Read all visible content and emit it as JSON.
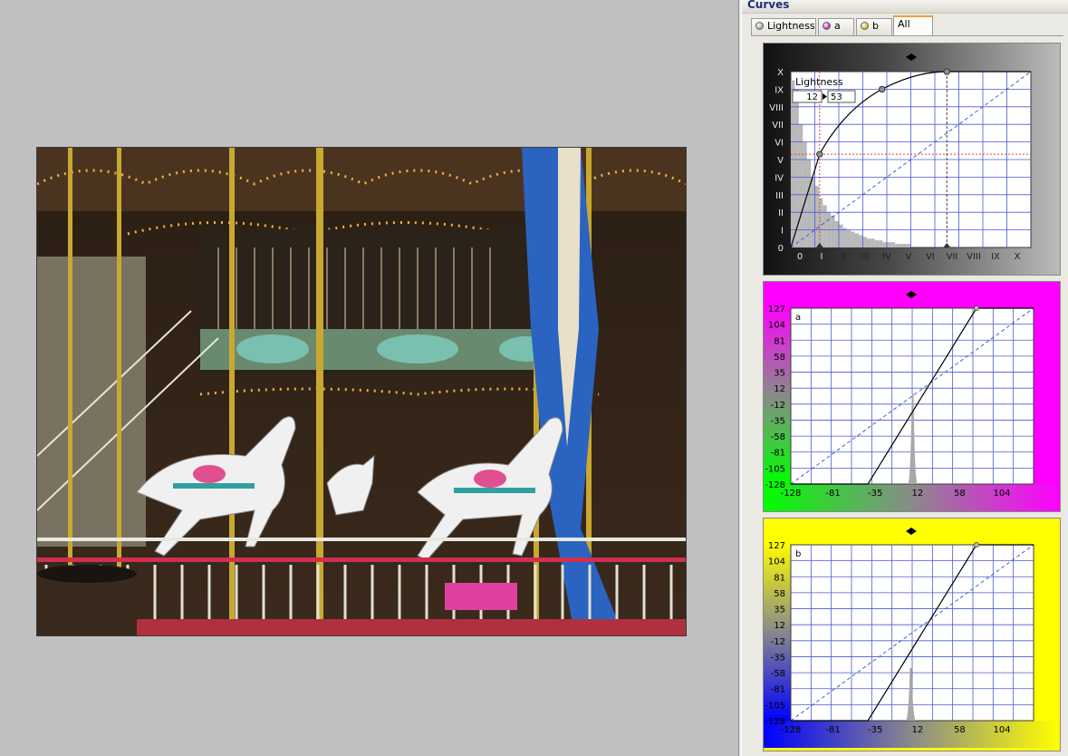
{
  "panel": {
    "title": "Curves",
    "tabs": [
      {
        "label": "Lightness",
        "icon": "gray-sphere-icon",
        "color": "#808080"
      },
      {
        "label": "a",
        "icon": "magenta-green-sphere-icon",
        "color": "#c040c0"
      },
      {
        "label": "b",
        "icon": "yellow-blue-sphere-icon",
        "color": "#60a040"
      },
      {
        "label": "All",
        "active": true
      }
    ]
  },
  "lightness_curve": {
    "channel_label": "Lightness",
    "input_value": "12",
    "output_value": "53",
    "x_ticks": [
      "0",
      "I",
      "II",
      "III",
      "IV",
      "V",
      "VI",
      "VII",
      "VIII",
      "IX",
      "X"
    ],
    "y_ticks": [
      "X",
      "IX",
      "VIII",
      "VII",
      "VI",
      "V",
      "IV",
      "III",
      "II",
      "I",
      "0"
    ],
    "curve_points": [
      [
        0,
        0
      ],
      [
        12,
        53
      ],
      [
        38,
        90
      ],
      [
        65,
        100
      ],
      [
        100,
        100
      ]
    ],
    "background": "gray-gradient"
  },
  "a_curve": {
    "channel_label": "a",
    "x_ticks": [
      "-128",
      "-81",
      "-35",
      "12",
      "58",
      "104"
    ],
    "y_ticks": [
      "127",
      "104",
      "81",
      "58",
      "35",
      "12",
      "-12",
      "-35",
      "-58",
      "-81",
      "-105",
      "-128"
    ],
    "curve_points": [
      [
        -128,
        -128
      ],
      [
        -47,
        -128
      ],
      [
        67,
        127
      ],
      [
        127,
        127
      ]
    ],
    "frame_color": "#ff00ff",
    "gradient": [
      "#00ff00",
      "#808080",
      "#ff00ff"
    ]
  },
  "b_curve": {
    "channel_label": "b",
    "x_ticks": [
      "-128",
      "-81",
      "-35",
      "12",
      "58",
      "104"
    ],
    "y_ticks": [
      "127",
      "104",
      "81",
      "58",
      "35",
      "12",
      "-12",
      "-35",
      "-58",
      "-81",
      "-105",
      "-128"
    ],
    "curve_points": [
      [
        -128,
        -128
      ],
      [
        -47,
        -128
      ],
      [
        67,
        127
      ],
      [
        127,
        127
      ]
    ],
    "frame_color": "#ffff00",
    "gradient": [
      "#0000ff",
      "#808080",
      "#ffff00"
    ]
  }
}
